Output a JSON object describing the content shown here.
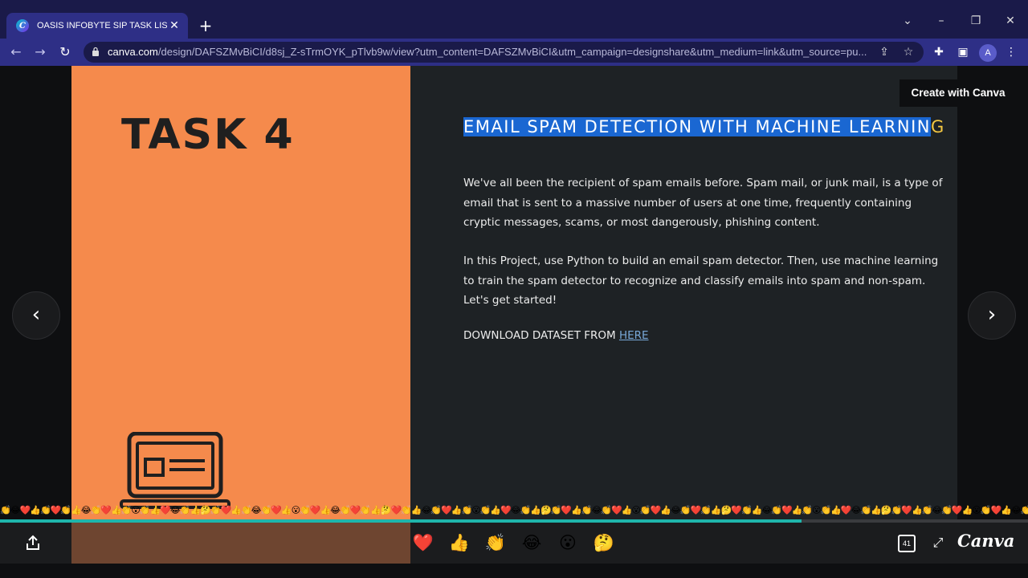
{
  "browser": {
    "tab_title": "OASIS INFOBYTE SIP TASK LIST",
    "tab_close": "✕",
    "new_tab": "+",
    "url_host": "canva.com",
    "url_path": "/design/DAFSZMvBiCI/d8sj_Z-sTrmOYK_pTlvb9w/view?utm_content=DAFSZMvBiCI&utm_campaign=designshare&utm_medium=link&utm_source=pu...",
    "profile_initial": "A",
    "icons": [
      "back-icon",
      "forward-icon",
      "reload-icon",
      "lock-icon",
      "share-page-icon",
      "bookmark-star-icon",
      "extensions-icon",
      "side-panel-icon",
      "menu-icon"
    ]
  },
  "slide": {
    "title": "TASK 4",
    "headline_selected": "EMAIL SPAM DETECTION WITH MACHINE LEARNIN",
    "headline_rest": "G",
    "paragraph1": "We've all been the recipient of spam emails before. Spam mail, or junk mail, is a type of email that is sent to a massive number of users at one time, frequently containing cryptic messages, scams, or most dangerously, phishing content.",
    "paragraph2": "In this Project, use Python to build an email spam detector. Then, use machine learning to train the spam detector to recognize and classify emails into spam and non-spam. Let's get started!",
    "download_text": "DOWNLOAD DATASET FROM ",
    "download_link": "HERE",
    "illustration": "laptop-icon"
  },
  "viewer": {
    "create_button": "Create with Canva",
    "prev_arrow": "‹",
    "next_arrow": "›",
    "emoji_strip": "👏😂❤️👍👏❤️👏👍😂👏❤️👍👏😮👏👍❤️😂👏👍🤔👏❤️👍👏😂👏❤️👍😮👏❤️👍😂👏❤️👏👍🤔❤️👏👍😂👏❤️👍👏😮👏👍❤️😂👏👍🤔👏❤️👍👏😂👏❤️👍😮👏❤️👍😂👏❤️👏👍🤔❤️👏👍😂👏❤️👍👏😮👏👍❤️😂👏👍🤔👏❤️👍👏😂👏❤️👍😮👏❤️👍😂👏❤️👏👍🤔❤️👏👍😂👏❤️👍👏😮👏👍❤️😂👏👍🤔👏❤️👍",
    "progress_fraction": 0.78,
    "reactions": [
      "❤️",
      "👍",
      "👏",
      "😂",
      "😮",
      "🤔"
    ],
    "slide_count": "41",
    "fullscreen_glyph": "⤢",
    "logo": "Canva",
    "accent_color": "#1fb5ab",
    "slide_left_color": "#f58a4c",
    "selection_color": "#1a67d2"
  }
}
